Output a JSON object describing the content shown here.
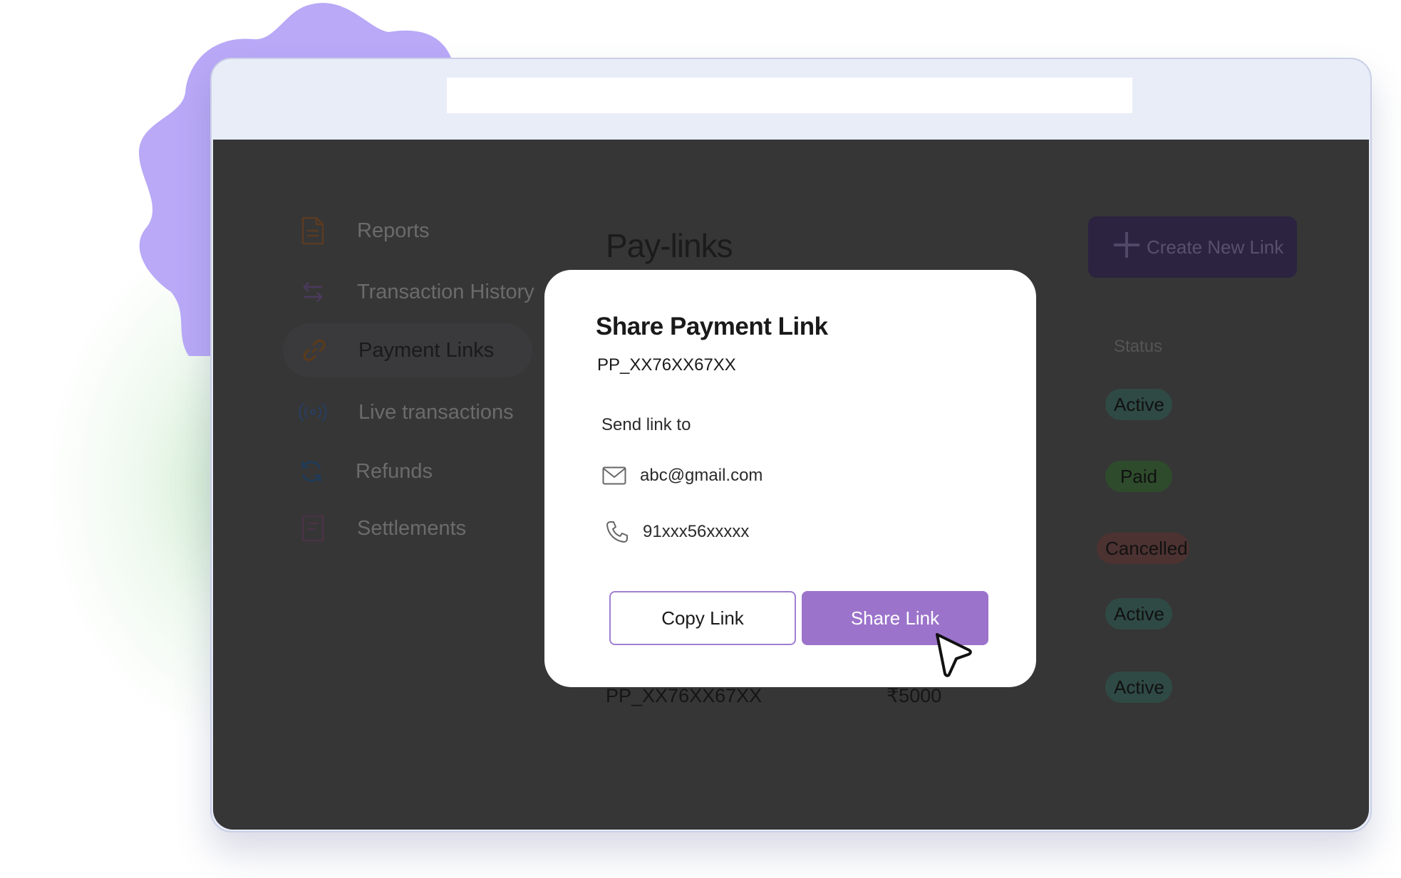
{
  "sidebar": {
    "items": [
      {
        "label": "Reports",
        "icon": "document-icon"
      },
      {
        "label": "Transaction History",
        "icon": "swap-arrows-icon"
      },
      {
        "label": "Payment Links",
        "icon": "link-icon",
        "active": true
      },
      {
        "label": "Live transactions",
        "icon": "broadcast-icon"
      },
      {
        "label": "Refunds",
        "icon": "refresh-icon"
      },
      {
        "label": "Settlements",
        "icon": "receipt-icon"
      }
    ]
  },
  "header": {
    "title": "Pay-links",
    "create_button": "Create New Link"
  },
  "table": {
    "status_header": "Status",
    "statuses": [
      "Active",
      "Paid",
      "Cancelled",
      "Active",
      "Active"
    ],
    "visible_row": {
      "id": "PP_XX76XX67XX",
      "amount": "₹5000"
    }
  },
  "modal": {
    "title": "Share Payment Link",
    "link_id": "PP_XX76XX67XX",
    "send_label": "Send link to",
    "email": "abc@gmail.com",
    "phone": "91xxx56xxxxx",
    "copy_button": "Copy Link",
    "share_button": "Share Link"
  },
  "colors": {
    "accent": "#9b73cb",
    "blob": "#b9a9f7",
    "overlay": "#363636"
  }
}
